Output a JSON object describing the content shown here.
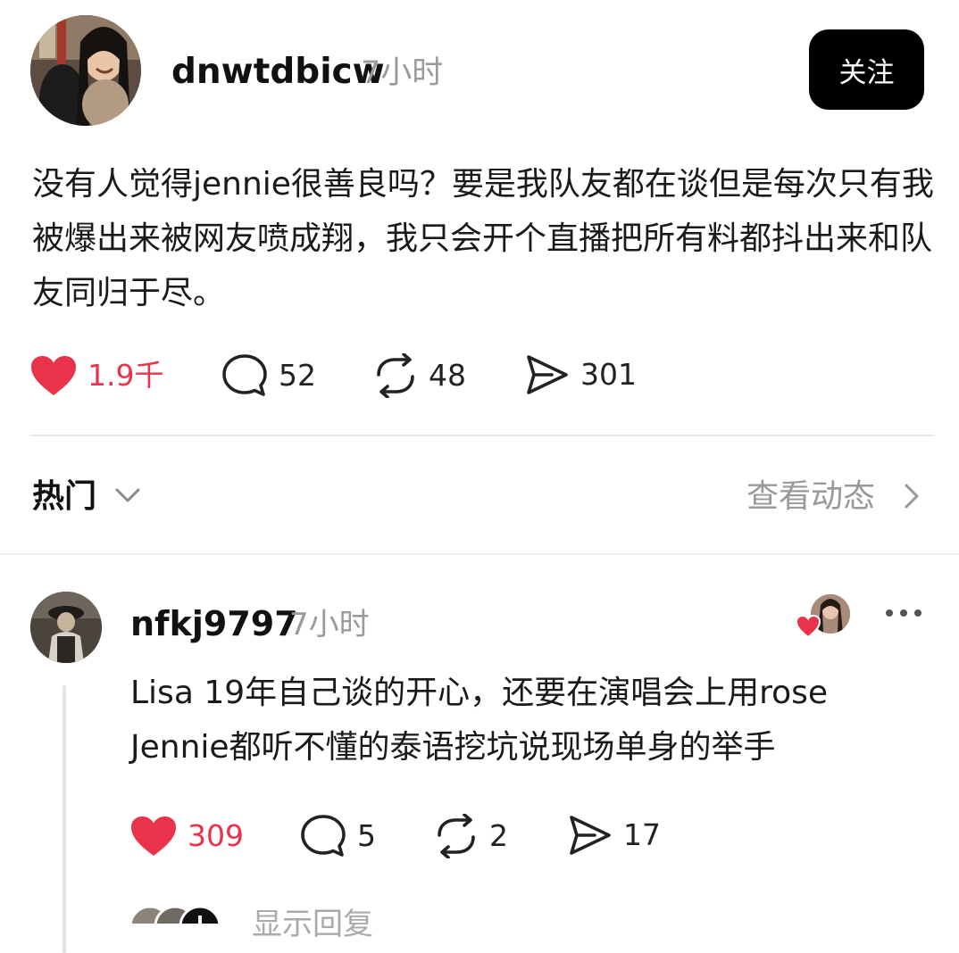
{
  "post": {
    "username": "dnwtdbicw",
    "time": "7小时",
    "follow_label": "关注",
    "text": "没有人觉得jennie很善良吗？要是我队友都在谈但是每次只有我被爆出来被网友喷成翔，我只会开个直播把所有料都抖出来和队友同归于尽。",
    "stats": {
      "likes": "1.9千",
      "comments": "52",
      "reposts": "48",
      "shares": "301"
    }
  },
  "sort": {
    "label": "热门",
    "view_activity": "查看动态"
  },
  "comment": {
    "username": "nfkj9797",
    "time": "7小时",
    "text_line1": "Lisa 19年自己谈的开心，还要在演唱会上用rose",
    "text_line2": "Jennie都听不懂的泰语挖坑说现场单身的举手",
    "stats": {
      "likes": "309",
      "comments": "5",
      "reposts": "2",
      "shares": "17"
    }
  },
  "reply_hint": "显示回复",
  "colors": {
    "like_red": "#e8334a",
    "follow_bg": "#000000",
    "muted_text": "#9a9a9a"
  }
}
